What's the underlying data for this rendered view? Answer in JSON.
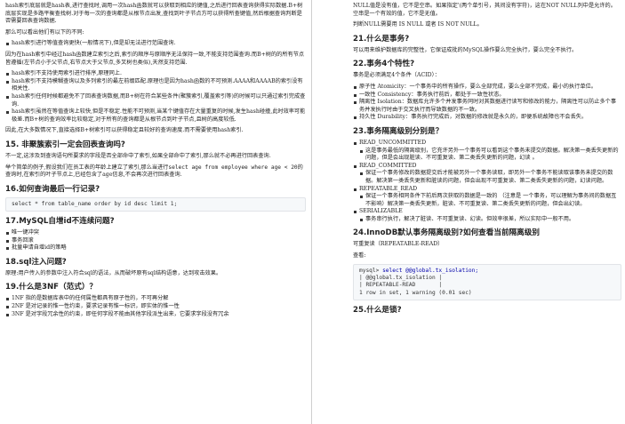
{
  "left": {
    "p1": "hash索引底层就是hash表,进行查找时,调用一次hash函数就可以获取到相应的键值,之后进行回表查询获得实际数据.B+树底层实现是多路平衡查找树.对于每一次的查询都是从根节点出发,查找到叶子节点方可以获得所查键值,然后根据查询判断是否需要回表查询数据.",
    "p2": "那么可以看出他们有以下的不同:",
    "list1": [
      "hash索引进行等值查询更快(一般情况下),但是却无法进行范围查询."
    ],
    "p3": "因为在hash索引中经过hash函数建立索引之后,索引的顺序与原顺序无法保持一致,不能支持范围查询.而B+树的的所有节点皆遵循(左节点小于父节点,右节点大于父节点,多叉树也类似),天然支持范围.",
    "list2": [
      "hash索引不支持使用索引进行排序,原理同上.",
      "hash索引不支持模糊查询以及多列索引的最左前缀匹配.原理也是因为hash函数的不可预测.AAAA和AAAAB的索引没有相关性.",
      "hash索引任何时候都避免不了回表查询数据,而B+树在符合某些条件(聚簇索引,覆盖索引等)的时候可以只通过索引完成查询.",
      "hash索引虽然在等值查询上较快,但是不稳定.性能不可预测,当某个键值存在大量重复的时候,发生hash碰撞,此时效率可能极差.而B+树的查询效率比较稳定,对于所有的查询都是从根节点到叶子节点,且树的高度较低."
    ],
    "p4": "因此,在大多数情况下,直接选择B+树索引可以获得稳定且较好的查询速度.而不需要使用hash索引.",
    "h15": "15. 非聚簇索引一定会回表查询吗?",
    "p5": "不一定,这涉及到查询语句所要求的字段是否全部命中了索引,如果全部命中了索引,那么就不必再进行回表查询.",
    "p6a": "举个简单的例子,假设我们在员工表的年龄上建立了索引,那么当进行",
    "p6code": "select age from employee where age < 20",
    "p6b": "的查询时,在索引的叶子节点上,已经包含了age信息,不会再次进行回表查询.",
    "h16": "16.如何查询最后一行记录?",
    "code16": "select * from table_name order by id desc limit 1;",
    "h17": "17.MySQL自增id不连续问题?",
    "list17": [
      "唯一键冲突",
      "事务回滚",
      "批量申请自增id的策略"
    ],
    "h18": "18.sql注入问题?",
    "p18": "原理:用户传入的参数中注入符合sql的语法，从而破坏原有sql结构语意，达到攻击效果。",
    "h19": "19.什么是3NF（范式）？",
    "list19": [
      "1NF 指的是数据库表中的任何属性都具有原子性的，不可再分解",
      "2NF 是对记录的惟一性约束，要求记录有惟一标识，即实体的惟一性",
      "3NF 是对字段冗余性的约束，即任何字段不能由其他字段派生出来，它要求字段没有冗余"
    ]
  },
  "right": {
    "p1": "NULL值是没有值，它不是空串。如果指定'(两个单引号，其间没有字符)，这在NOT NULL列中是允许的。空串是一个有效的值，它不是无值。",
    "p2": "判断NULL需要用 IS NULL 或者 IS NOT NULL。",
    "h21": "21.什么是事务?",
    "p21": "可以用来维护数据库的完整性，它保证成批的MySQL操作要么完全执行，要么完全不执行。",
    "h22": "22.事务4个特性?",
    "p22": "事务是必须满足4个条件（ACID）：",
    "list22": [
      "原子性 Atomicity：一个事务中的所有操作，要么全部完成，要么全部不完成，最小的执行单位。",
      "一致性 Consistency：事务执行前后，都处于一致性状态。",
      "隔离性 Isolation：数据库允许多个并发事务同时对其数据进行读写和修改的能力，隔离性可以防止多个事务并发执行时由于交叉执行而导致数据的不一致。",
      "持久性 Durability：事务执行完成后，对数据的修改就是永久的，即便系统故障也不会丢失。"
    ],
    "h23": "23.事务隔离级别分别是？",
    "list23": [
      {
        "title": "READ_UNCOMMITTED",
        "desc": "这是事务最低的隔离级别，它充许另外一个事务可以看到这个事务未提交的数据。解决第一类丢失更新的问题，但是会出现脏读、不可重复读、第二类丢失更新的问题，幻读 。"
      },
      {
        "title": "READ_COMMITTED",
        "desc": "保证一个事务修改的数据提交后才能被另外一个事务读取，即另外一个事务不能读取该事务未提交的数据。解决第一类丢失更新和脏读的问题，但会出现不可重复读、第二类丢失更新的问题，幻读问题。"
      },
      {
        "title": "REPEATABLE_READ",
        "desc": "保证一个事务相同条件下前后两次获取的数据是一致的 （注意是 一个事务，可以理解为事务间的数据互不影响）解决第一类丢失更新，脏读、不可重复读、第二类丢失更新的问题，但会出幻读。"
      },
      {
        "title": "SERIALIZABLE",
        "desc": "事务串行执行，解决了脏读、不可重复读、幻读。但效率很差，所以实际中一般不用。"
      }
    ],
    "h24": "24.InnoDB默认事务隔离级别?如何查看当前隔离级别",
    "p24a": "可重复读（REPEATABLE-READ）",
    "p24b": "查看:",
    "code24": {
      "prompt": "mysql> ",
      "cmd": "select @@global.tx_isolation;",
      "col": "| @@global.tx_isolation |",
      "val": "| REPEATABLE-READ       |",
      "result": "1 row in set, 1 warning (0.01 sec)"
    },
    "h25": "25.什么是锁?"
  }
}
